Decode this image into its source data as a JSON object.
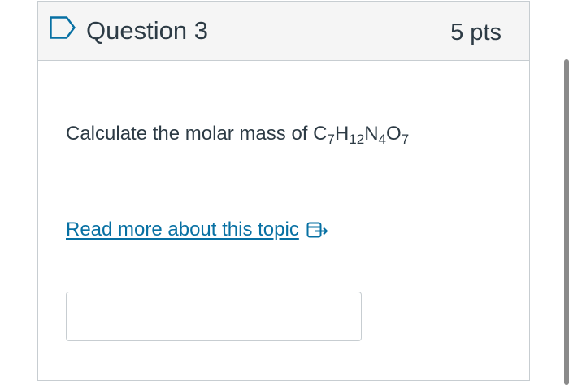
{
  "question": {
    "title": "Question 3",
    "points": "5 pts",
    "prompt": "Calculate the molar mass of ",
    "formula": {
      "el1": "C",
      "n1": "7",
      "el2": "H",
      "n2": "12",
      "el3": "N",
      "n3": "4",
      "el4": "O",
      "n4": "7"
    },
    "read_more_label": "Read more about this topic",
    "answer_value": "",
    "answer_placeholder": ""
  },
  "icons": {
    "flag": "flag-outline-icon",
    "external": "external-link-icon"
  },
  "colors": {
    "header_bg": "#f5f5f5",
    "border": "#c7cdd1",
    "text": "#2d3b45",
    "link": "#0770a3",
    "flag_stroke": "#0770a3"
  }
}
